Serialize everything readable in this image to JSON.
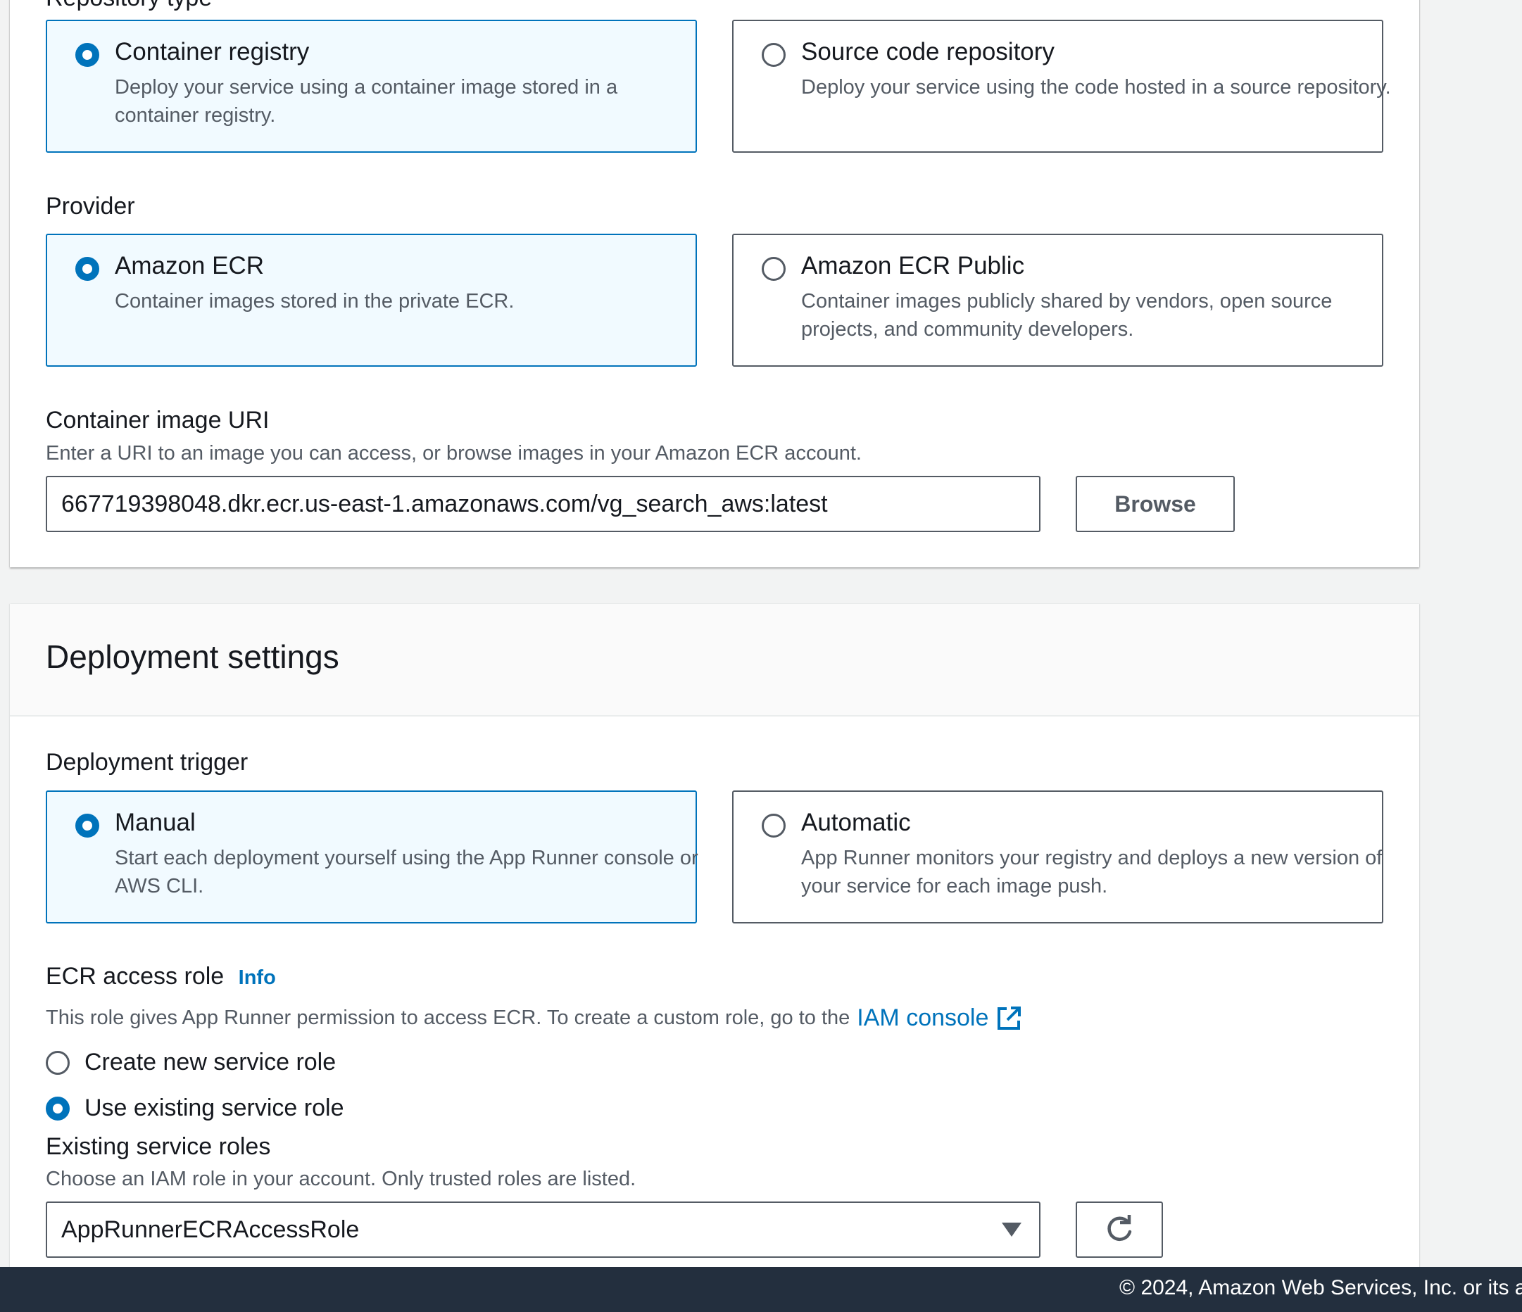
{
  "source": {
    "repository_type_label": "Repository type",
    "repository_type_options": [
      {
        "title": "Container registry",
        "description": "Deploy your service using a container image stored in a container registry.",
        "selected": true
      },
      {
        "title": "Source code repository",
        "description": "Deploy your service using the code hosted in a source repository.",
        "selected": false
      }
    ],
    "provider_label": "Provider",
    "provider_options": [
      {
        "title": "Amazon ECR",
        "description": "Container images stored in the private ECR.",
        "selected": true
      },
      {
        "title": "Amazon ECR Public",
        "description": "Container images publicly shared by vendors, open source projects, and community developers.",
        "selected": false
      }
    ],
    "image_uri": {
      "label": "Container image URI",
      "description": "Enter a URI to an image you can access, or browse images in your Amazon ECR account.",
      "value": "667719398048.dkr.ecr.us-east-1.amazonaws.com/vg_search_aws:latest",
      "browse_label": "Browse"
    }
  },
  "deployment": {
    "title": "Deployment settings",
    "trigger_label": "Deployment trigger",
    "trigger_options": [
      {
        "title": "Manual",
        "description": "Start each deployment yourself using the App Runner console or AWS CLI.",
        "selected": true
      },
      {
        "title": "Automatic",
        "description": "App Runner monitors your registry and deploys a new version of your service for each image push.",
        "selected": false
      }
    ],
    "ecr_role": {
      "label": "ECR access role",
      "info_label": "Info",
      "description": "This role gives App Runner permission to access ECR. To create a custom role, go to the",
      "iam_link": "IAM console",
      "options": [
        {
          "label": "Create new service role",
          "selected": false
        },
        {
          "label": "Use existing service role",
          "selected": true
        }
      ],
      "existing_label": "Existing service roles",
      "existing_description": "Choose an IAM role in your account. Only trusted roles are listed.",
      "selected_role": "AppRunnerECRAccessRole"
    }
  },
  "footer": {
    "text": "© 2024, Amazon Web Services, Inc. or its a"
  },
  "icons": {
    "dropdown": "caret-down-icon",
    "refresh": "refresh-icon",
    "external_link": "external-link-icon"
  },
  "colors": {
    "accent": "#0073bb",
    "selected_tile_bg": "#f1faff",
    "footer_bg": "#232f3e",
    "page_bg": "#f2f3f3"
  }
}
